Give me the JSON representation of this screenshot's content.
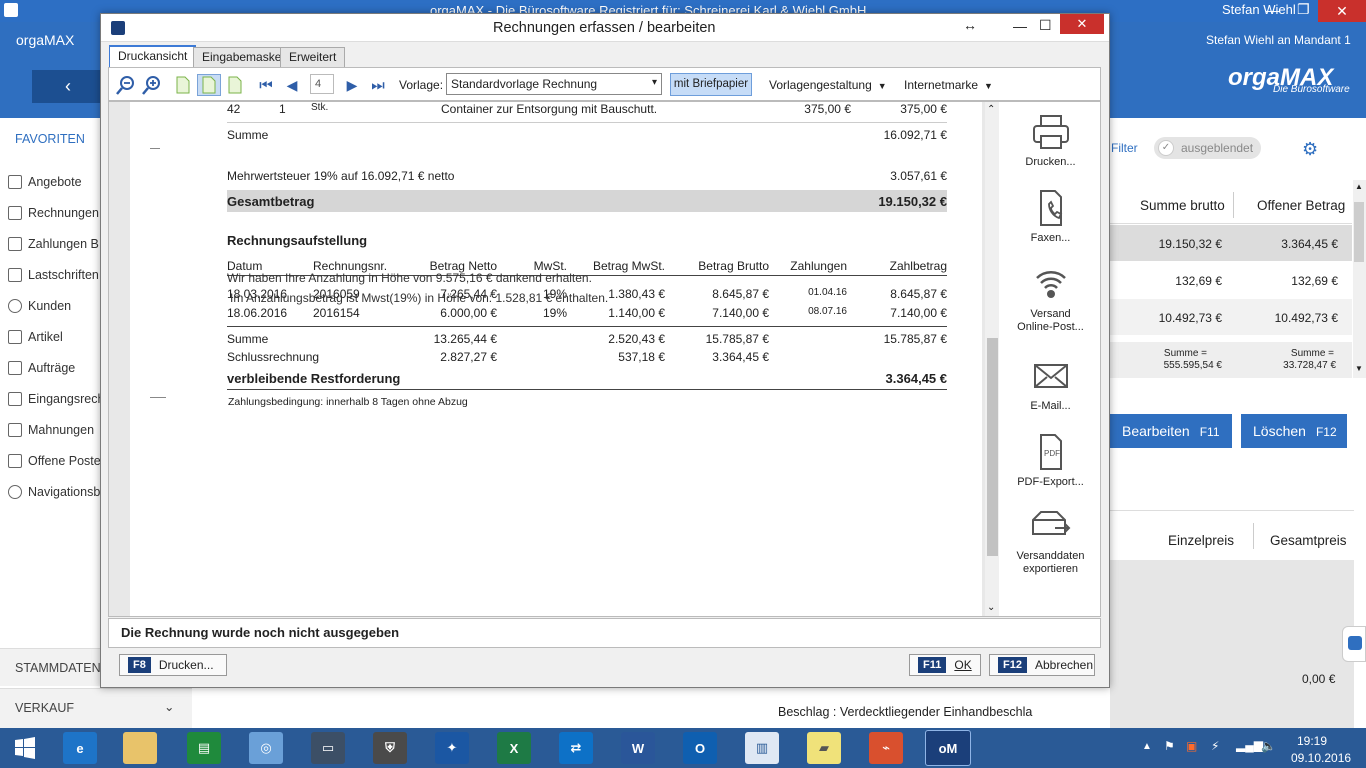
{
  "app": {
    "title_bar": "orgaMAX - Die Bürosoftware Registriert für: Schreinerei Karl & Wiebl GmbH",
    "user": "Stefan Wiehl",
    "brand_name": "orgaMAX",
    "logo_text": "orgaMAX",
    "logo_sub": "Die Bürosoftware",
    "user_line": "Stefan Wiehl an Mandant 1",
    "colors": {
      "brand": "#2f6fc0",
      "taskbar": "#2a5a96",
      "accent_button": "#2f6fc0"
    }
  },
  "sidebar": {
    "favorites_label": "FAVORITEN",
    "items": [
      {
        "label": "Angebote",
        "icon": "document-icon"
      },
      {
        "label": "Rechnungen",
        "icon": "euro-document-icon"
      },
      {
        "label": "Zahlungen B",
        "icon": "bank-icon"
      },
      {
        "label": "Lastschriften",
        "icon": "direct-debit-icon"
      },
      {
        "label": "Kunden",
        "icon": "customers-icon"
      },
      {
        "label": "Artikel",
        "icon": "tag-icon"
      },
      {
        "label": "Aufträge",
        "icon": "orders-icon"
      },
      {
        "label": "Eingangsrech",
        "icon": "incoming-invoice-icon"
      },
      {
        "label": "Mahnungen",
        "icon": "reminder-icon"
      },
      {
        "label": "Offene Poste",
        "icon": "open-items-icon"
      },
      {
        "label": "Navigationsb",
        "icon": "navigation-icon"
      }
    ],
    "stammdaten_label": "STAMMDATEN",
    "verkauf_label": "VERKAUF"
  },
  "right_panel": {
    "filter_label": "Filter",
    "toggle_label": "ausgeblendet",
    "col_brutto": "Summe brutto",
    "col_offen": "Offener Betrag",
    "rows": [
      {
        "brutto": "19.150,32 €",
        "offen": "3.364,45 €"
      },
      {
        "brutto": "132,69 €",
        "offen": "132,69 €"
      },
      {
        "brutto": "10.492,73 €",
        "offen": "10.492,73 €"
      }
    ],
    "sum_label": "Summe =",
    "sum_brutto": "555.595,54 €",
    "sum_offen": "33.728,47 €",
    "edit_button": "Bearbeiten",
    "edit_key": "F11",
    "delete_button": "Löschen",
    "delete_key": "F12",
    "col_einzelpreis": "Einzelpreis",
    "col_gesamtpreis": "Gesamtpreis",
    "bottom_value": "0,00 €",
    "beschlag_text": "Beschlag : Verdecktliegender Einhandbeschla"
  },
  "dialog": {
    "title": "Rechnungen erfassen / bearbeiten",
    "tabs": [
      "Druckansicht",
      "Eingabemaske",
      "Erweitert"
    ],
    "toolbar": {
      "page_number": "4",
      "vorlage_label": "Vorlage:",
      "vorlage_value": "Standardvorlage Rechnung",
      "briefpapier_button": "mit Briefpapier",
      "vorlagengestaltung": "Vorlagengestaltung",
      "internetmarke": "Internetmarke"
    },
    "invoice": {
      "item": {
        "pos": "42",
        "qty": "1",
        "unit": "Stk.",
        "desc": "Container zur Entsorgung mit Bauschutt.",
        "price": "375,00 €",
        "total": "375,00 €"
      },
      "summe_label": "Summe",
      "summe_value": "16.092,71 €",
      "mwst_label": "Mehrwertsteuer 19% auf 16.092,71 € netto",
      "mwst_value": "3.057,61 €",
      "gesamt_label": "Gesamtbetrag",
      "gesamt_value": "19.150,32 €",
      "aufstellung_title": "Rechnungsaufstellung",
      "headers": [
        "Datum",
        "Rechnungsnr.",
        "Betrag Netto",
        "MwSt.",
        "Betrag MwSt.",
        "Betrag Brutto",
        "Zahlungen",
        "Zahlbetrag"
      ],
      "overlay_line1": "Wir haben Ihre Anzahlung in Höhe von 9.575,16 € dankend erhalten.",
      "overlay_line2": "Im Anzahlungsbetrag ist Mwst(19%) in Höhe von: 1.528,81 € enthalten.",
      "rows": [
        {
          "datum": "18.03.2016",
          "nr": "2016059",
          "netto": "7.265,44 €",
          "mwst": "19%",
          "betrag_mwst": "1.380,43 €",
          "brutto": "8.645,87 €",
          "zahlung": "01.04.16",
          "zahlbetrag": "8.645,87 €"
        },
        {
          "datum": "18.06.2016",
          "nr": "2016154",
          "netto": "6.000,00 €",
          "mwst": "19%",
          "betrag_mwst": "1.140,00 €",
          "brutto": "7.140,00 €",
          "zahlung": "08.07.16",
          "zahlbetrag": "7.140,00 €"
        }
      ],
      "summe2_label": "Summe",
      "summe2_netto": "13.265,44 €",
      "summe2_mwst": "2.520,43 €",
      "summe2_brutto": "15.785,87 €",
      "summe2_zahlbetrag": "15.785,87 €",
      "schluss_label": "Schlussrechnung",
      "schluss_netto": "2.827,27 €",
      "schluss_mwst": "537,18 €",
      "schluss_brutto": "3.364,45 €",
      "rest_label": "verbleibende Restforderung",
      "rest_value": "3.364,45 €",
      "zahlungsbedingung": "Zahlungsbedingung: innerhalb 8 Tagen ohne Abzug"
    },
    "actions": [
      {
        "label": "Drucken..."
      },
      {
        "label": "Faxen..."
      },
      {
        "label": "Versand Online-Post..."
      },
      {
        "label": "E-Mail..."
      },
      {
        "label": "PDF-Export..."
      },
      {
        "label": "Versanddaten exportieren"
      }
    ],
    "status_message": "Die Rechnung wurde noch nicht ausgegeben",
    "print_key": "F8",
    "print_label": "Drucken...",
    "ok_key": "F11",
    "ok_label": "OK",
    "cancel_key": "F12",
    "cancel_label": "Abbrechen"
  },
  "taskbar": {
    "time": "19:19",
    "date": "09.10.2016"
  }
}
